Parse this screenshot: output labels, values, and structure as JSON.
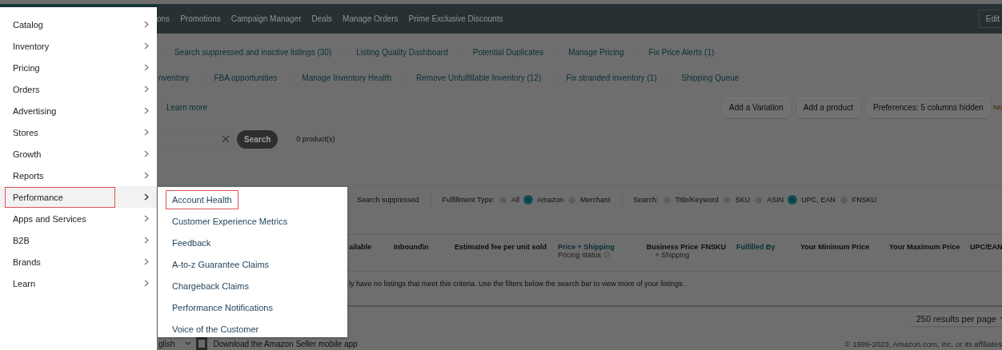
{
  "top_nav": {
    "items": [
      "ons",
      "Promotions",
      "Campaign Manager",
      "Deals",
      "Manage Orders",
      "Prime Exclusive Discounts"
    ],
    "edit_button": "Edit"
  },
  "subnav_rows": [
    [
      "Search suppressed and inactive listings (30)",
      "Listing Quality Dashboard",
      "Potential Duplicates",
      "Manage Pricing",
      "Fix Price Alerts (1)"
    ],
    [
      "nventory",
      "FBA opportunities",
      "Manage Inventory Health",
      "Remove Unfulfillable Inventory (12)",
      "Fix stranded inventory (1)",
      "Shipping Queue"
    ]
  ],
  "learn_more": "Learn more",
  "actions": [
    "Add a Variation",
    "Add a product",
    "Preferences: 5 columns hidden"
  ],
  "new_badge": "NE",
  "search": {
    "button": "Search",
    "count": "0 product(s)"
  },
  "filters": {
    "search_suppressed": "Search suppressed",
    "groups": [
      {
        "label": "Fulfillment Type:",
        "options": [
          {
            "label": "All",
            "selected": false
          },
          {
            "label": "Amazon",
            "selected": true
          },
          {
            "label": "Merchant",
            "selected": false
          }
        ]
      },
      {
        "label": "Search:",
        "options": [
          {
            "label": "Title/Keyword",
            "selected": false
          },
          {
            "label": "SKU",
            "selected": false
          },
          {
            "label": "ASIN",
            "selected": false
          },
          {
            "label": "UPC, EAN",
            "selected": true
          },
          {
            "label": "FNSKU",
            "selected": false
          }
        ]
      }
    ]
  },
  "columns": [
    {
      "title": "ailable",
      "kind": "plain"
    },
    {
      "title": "Inbound\\n",
      "kind": "plain"
    },
    {
      "title": "Estimated fee per unit sold",
      "kind": "plain"
    },
    {
      "title": "Price + Shipping",
      "subtitle": "Pricing status",
      "kind": "link"
    },
    {
      "title": "Business Price",
      "subtitle": "+ Shipping",
      "kind": "plain"
    },
    {
      "title": "FNSKU",
      "kind": "plain"
    },
    {
      "title": "Fulfilled By",
      "kind": "link"
    },
    {
      "title": "Your Minimum Price",
      "kind": "plain"
    },
    {
      "title": "Your Maximum Price",
      "kind": "plain"
    },
    {
      "title": "UPC/EAN",
      "kind": "plain"
    }
  ],
  "empty_message": "ly have no listings that meet this criteria. Use the filters below the search bar to view more of your listings.",
  "page_size": "250 results per page",
  "footer": {
    "language": "glish",
    "app_link": "Download the Amazon Seller mobile app",
    "copyright": "© 1999-2023, Amazon.com, Inc. or its affiliates"
  },
  "menu": {
    "items": [
      {
        "label": "Catalog",
        "selected": false
      },
      {
        "label": "Inventory",
        "selected": false
      },
      {
        "label": "Pricing",
        "selected": false
      },
      {
        "label": "Orders",
        "selected": false
      },
      {
        "label": "Advertising",
        "selected": false
      },
      {
        "label": "Stores",
        "selected": false
      },
      {
        "label": "Growth",
        "selected": false
      },
      {
        "label": "Reports",
        "selected": false
      },
      {
        "label": "Performance",
        "selected": true
      },
      {
        "label": "Apps and Services",
        "selected": false
      },
      {
        "label": "B2B",
        "selected": false
      },
      {
        "label": "Brands",
        "selected": false
      },
      {
        "label": "Learn",
        "selected": false
      }
    ],
    "submenu": [
      {
        "label": "Account Health",
        "selected": true
      },
      {
        "label": "Customer Experience Metrics",
        "selected": false
      },
      {
        "label": "Feedback",
        "selected": false
      },
      {
        "label": "A-to-z Guarantee Claims",
        "selected": false
      },
      {
        "label": "Chargeback Claims",
        "selected": false
      },
      {
        "label": "Performance Notifications",
        "selected": false
      },
      {
        "label": "Voice of the Customer",
        "selected": false
      }
    ]
  }
}
